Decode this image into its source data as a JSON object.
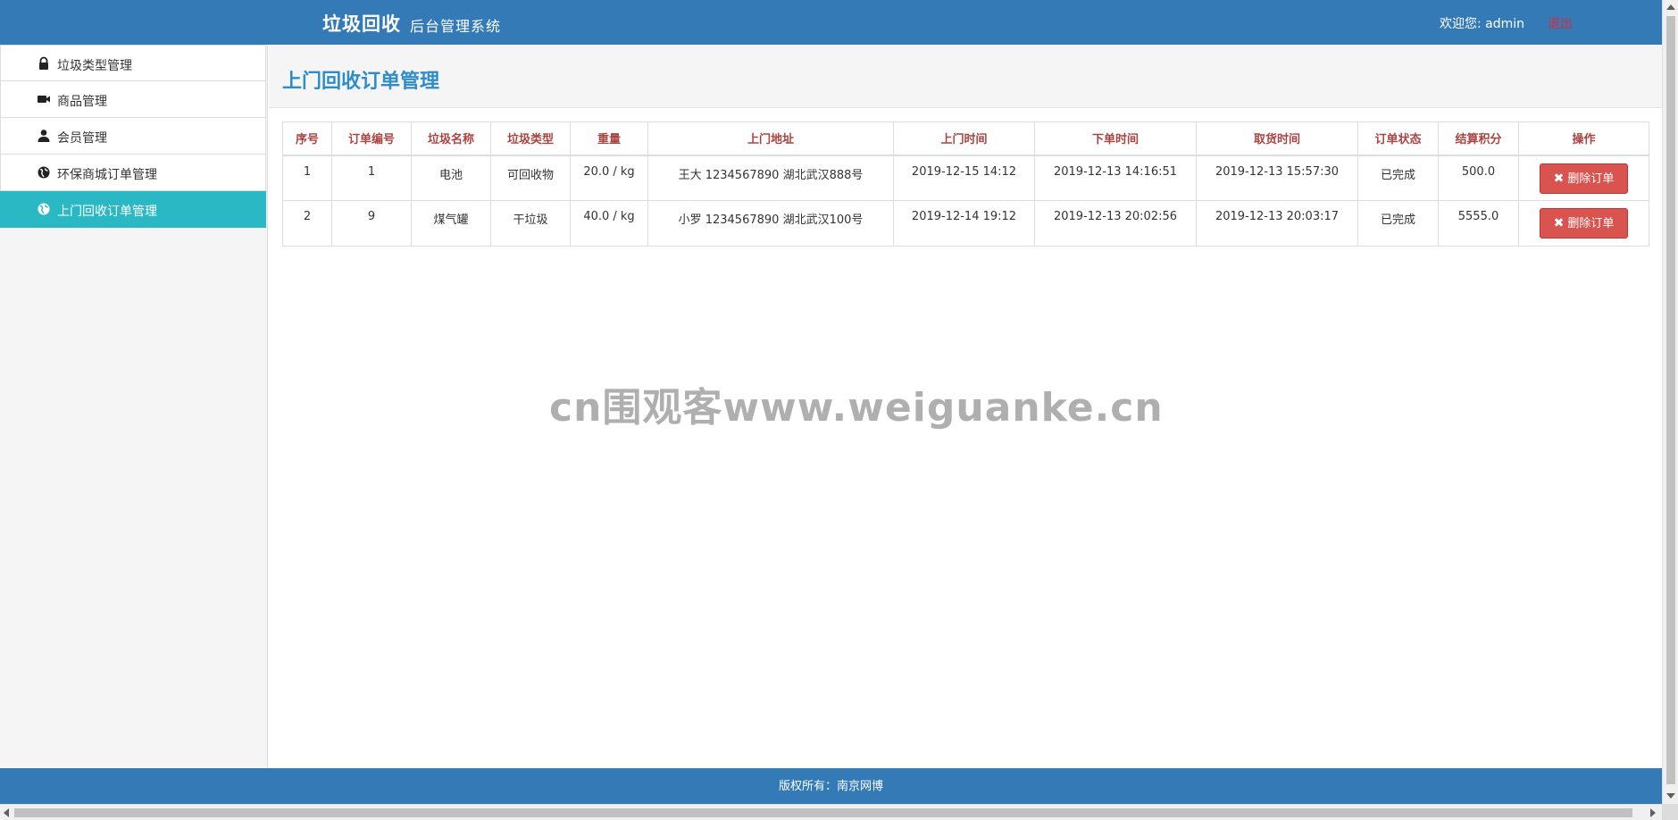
{
  "header": {
    "title": "垃圾回收",
    "subtitle": "后台管理系统",
    "welcome": "欢迎您: admin",
    "logout": "退出"
  },
  "sidebar": {
    "items": [
      {
        "label": "垃圾类型管理",
        "icon": "lock-icon"
      },
      {
        "label": "商品管理",
        "icon": "video-camera-icon"
      },
      {
        "label": "会员管理",
        "icon": "user-icon"
      },
      {
        "label": "环保商城订单管理",
        "icon": "globe-icon"
      },
      {
        "label": "上门回收订单管理",
        "icon": "globe-icon",
        "active": true
      }
    ]
  },
  "main": {
    "page_title": "上门回收订单管理",
    "columns": [
      "序号",
      "订单编号",
      "垃圾名称",
      "垃圾类型",
      "重量",
      "上门地址",
      "上门时间",
      "下单时间",
      "取货时间",
      "订单状态",
      "结算积分",
      "操作"
    ],
    "rows": [
      {
        "index": "1",
        "order_no": "1",
        "name": "电池",
        "type": "可回收物",
        "weight": "20.0 / kg",
        "address": "王大 1234567890 湖北武汉888号",
        "visit_time": "2019-12-15 14:12",
        "order_time": "2019-12-13 14:16:51",
        "pickup_time": "2019-12-13 15:57:30",
        "status": "已完成",
        "points": "500.0",
        "action": "删除订单"
      },
      {
        "index": "2",
        "order_no": "9",
        "name": "煤气罐",
        "type": "干垃圾",
        "weight": "40.0 / kg",
        "address": "小罗 1234567890 湖北武汉100号",
        "visit_time": "2019-12-14 19:12",
        "order_time": "2019-12-13 20:02:56",
        "pickup_time": "2019-12-13 20:03:17",
        "status": "已完成",
        "points": "5555.0",
        "action": "删除订单"
      }
    ]
  },
  "watermark": "cn围观客www.weiguanke.cn",
  "footer": {
    "copyright": "版权所有：南京网博"
  },
  "colors": {
    "header_bg": "#337ab7",
    "active_item_bg": "#2ab9c4",
    "title_color": "#2d8ccb",
    "column_header_color": "#a94442",
    "danger": "#d9534f",
    "logout_color": "#d9293a"
  }
}
